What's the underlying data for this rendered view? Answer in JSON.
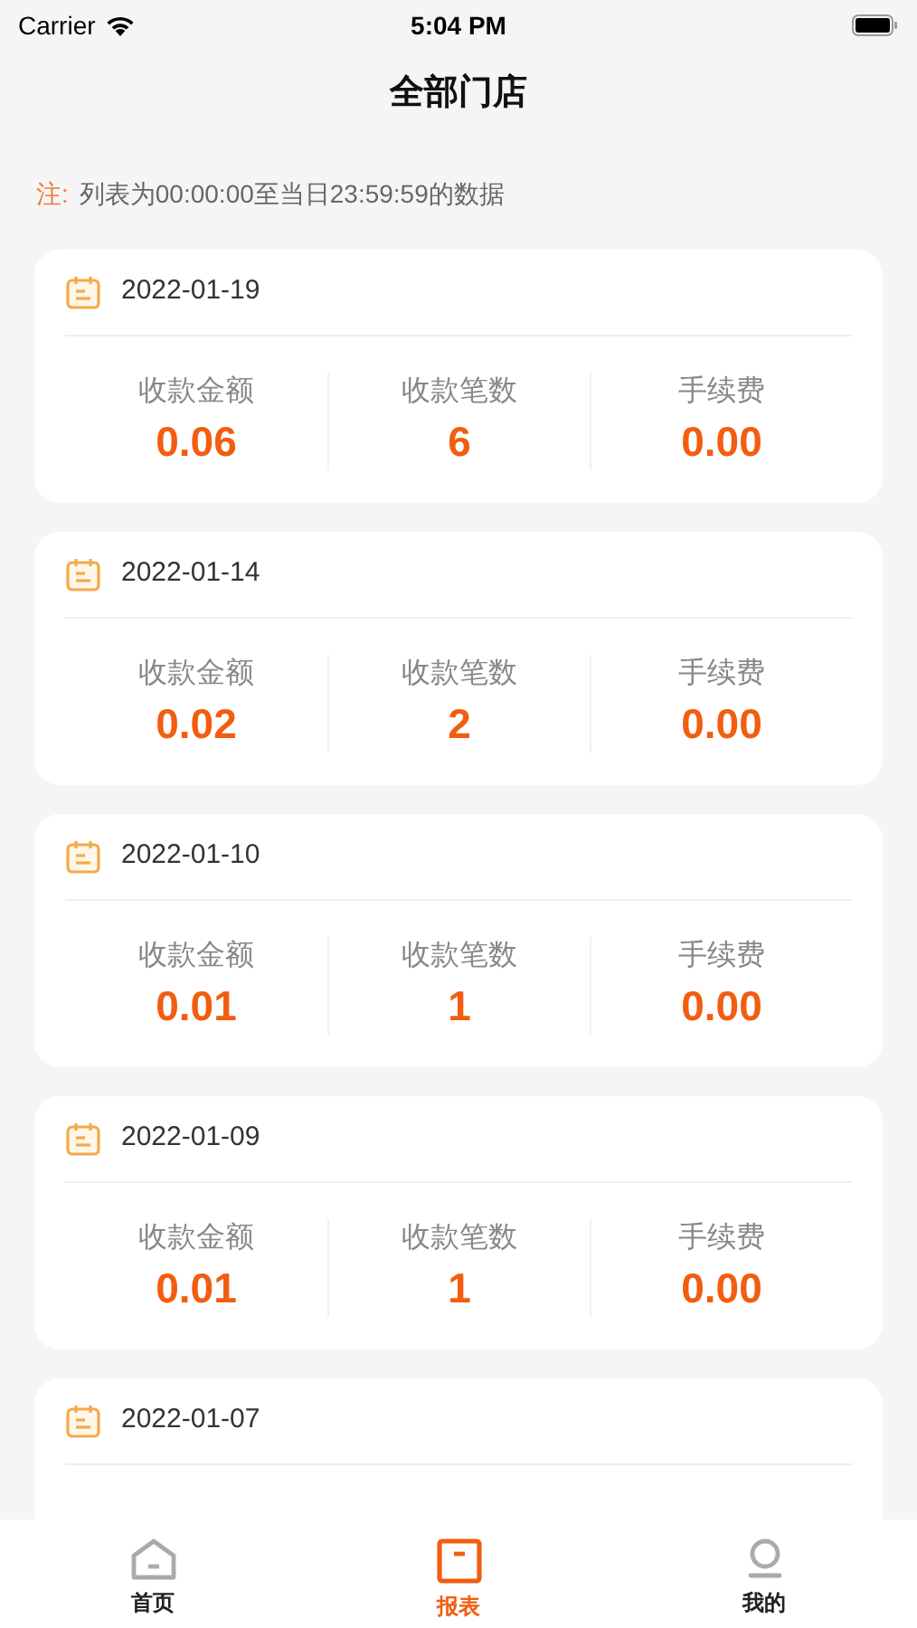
{
  "status_bar": {
    "carrier": "Carrier",
    "time": "5:04 PM"
  },
  "title": "全部门店",
  "note": {
    "label": "注:",
    "text": "列表为00:00:00至当日23:59:59的数据"
  },
  "records": [
    {
      "date": "2022-01-19",
      "stats": [
        {
          "label": "收款金额",
          "value": "0.06"
        },
        {
          "label": "收款笔数",
          "value": "6"
        },
        {
          "label": "手续费",
          "value": "0.00"
        }
      ]
    },
    {
      "date": "2022-01-14",
      "stats": [
        {
          "label": "收款金额",
          "value": "0.02"
        },
        {
          "label": "收款笔数",
          "value": "2"
        },
        {
          "label": "手续费",
          "value": "0.00"
        }
      ]
    },
    {
      "date": "2022-01-10",
      "stats": [
        {
          "label": "收款金额",
          "value": "0.01"
        },
        {
          "label": "收款笔数",
          "value": "1"
        },
        {
          "label": "手续费",
          "value": "0.00"
        }
      ]
    },
    {
      "date": "2022-01-09",
      "stats": [
        {
          "label": "收款金额",
          "value": "0.01"
        },
        {
          "label": "收款笔数",
          "value": "1"
        },
        {
          "label": "手续费",
          "value": "0.00"
        }
      ]
    },
    {
      "date": "2022-01-07"
    }
  ],
  "tab_bar": [
    {
      "kind": "home",
      "label": "首页",
      "selected": false
    },
    {
      "kind": "report",
      "label": "报表",
      "selected": true
    },
    {
      "kind": "profile",
      "label": "我的",
      "selected": false
    }
  ]
}
